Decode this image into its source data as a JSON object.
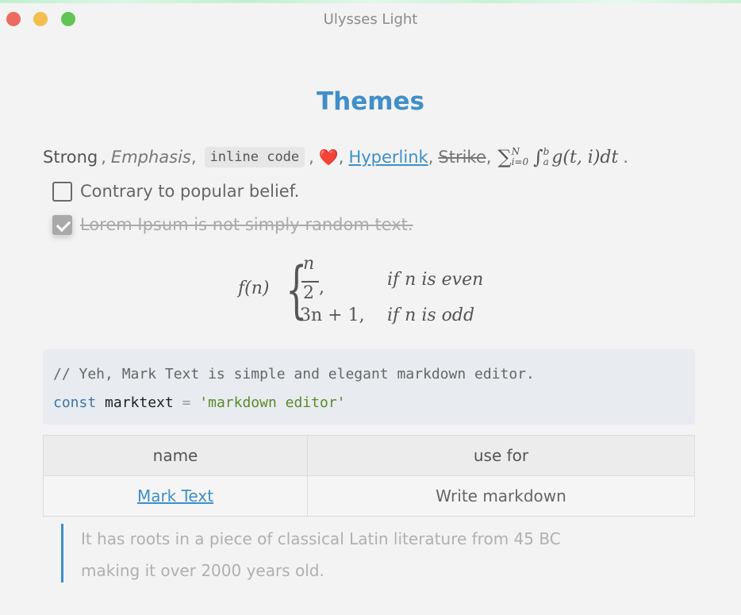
{
  "window": {
    "title": "Ulysses Light"
  },
  "heading": "Themes",
  "inline": {
    "strong": "Strong",
    "sep1": ",",
    "emphasis": "Emphasis",
    "sep2": ",",
    "code": "inline code",
    "sep3": ",",
    "emoji": "❤️",
    "sep4": ",",
    "link": "Hyperlink",
    "sep5": ",",
    "strike": "Strike",
    "sep6": ",",
    "math_sum": "∑",
    "math_sum_sup": "N",
    "math_sum_sub": "i=0",
    "math_int": "∫",
    "math_int_sup": "b",
    "math_int_sub": "a",
    "math_body": "g(t, i)dt",
    "sep7": "."
  },
  "tasks": [
    {
      "label": "Contrary to popular belief.",
      "checked": false
    },
    {
      "label": "Lorem Ipsum is not simply random text.",
      "checked": true
    }
  ],
  "formula": {
    "lhs": "f(n)",
    "brace": "{",
    "case1_num": "n",
    "case1_den": "2",
    "case1_comma": ",",
    "case1_cond": "if n is even",
    "case2_expr": "3n + 1,",
    "case2_cond": "if n is odd"
  },
  "code": {
    "comment": "// Yeh, Mark Text is simple and elegant markdown editor.",
    "keyword": "const",
    "variable": "marktext",
    "operator": "=",
    "string": "'markdown editor'"
  },
  "table": {
    "headers": [
      "name",
      "use for"
    ],
    "rows": [
      {
        "name": "Mark Text",
        "use_for": "Write markdown"
      }
    ]
  },
  "blockquote": {
    "line1": "It has roots in a piece of classical Latin literature from 45 BC",
    "line2": "making it over 2000 years old."
  },
  "colors": {
    "accent": "#3f8fc8",
    "traffic_close": "#ec6a5e",
    "traffic_min": "#f3be4f",
    "traffic_max": "#61c454"
  }
}
